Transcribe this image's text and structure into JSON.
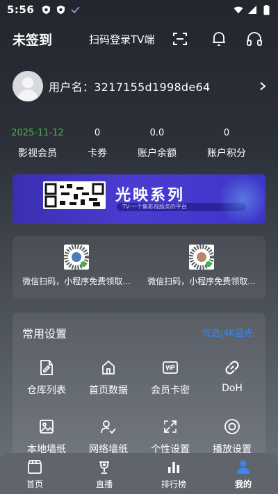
{
  "status_bar": {
    "time": "5:56"
  },
  "header": {
    "title": "未签到",
    "scan_label": "扫码登录TV端"
  },
  "user": {
    "name": "用户名：3217155d1998de64"
  },
  "stats": [
    {
      "value": "2025-11-12",
      "label": "影视会员"
    },
    {
      "value": "0",
      "label": "卡券"
    },
    {
      "value": "0.0",
      "label": "账户余额"
    },
    {
      "value": "0",
      "label": "账户积分"
    }
  ],
  "banner": {
    "title": "光映系列",
    "subtitle": "TV·一个集影视服务的平台"
  },
  "qr_cards": [
    {
      "caption": "微信扫码，小程序免费领取..."
    },
    {
      "caption": "微信扫码，小程序免费领取..."
    }
  ],
  "settings": {
    "title": "常用设置",
    "link": "优选|4K蓝光",
    "items": [
      {
        "label": "仓库列表",
        "icon": "document-edit-icon"
      },
      {
        "label": "首页数据",
        "icon": "home-icon"
      },
      {
        "label": "会员卡密",
        "icon": "vip-card-icon"
      },
      {
        "label": "DoH",
        "icon": "link-icon"
      },
      {
        "label": "本地墙纸",
        "icon": "image-icon"
      },
      {
        "label": "网络墙纸",
        "icon": "user-check-icon"
      },
      {
        "label": "个性设置",
        "icon": "expand-icon"
      },
      {
        "label": "播放设置",
        "icon": "play-circle-icon"
      }
    ]
  },
  "nav": [
    {
      "label": "首页",
      "icon": "clapperboard-icon"
    },
    {
      "label": "直播",
      "icon": "trophy-icon"
    },
    {
      "label": "排行榜",
      "icon": "bar-chart-icon"
    },
    {
      "label": "我的",
      "icon": "person-icon"
    }
  ],
  "colors": {
    "accent_blue": "#3b86f2",
    "member_green": "#4caf50"
  }
}
